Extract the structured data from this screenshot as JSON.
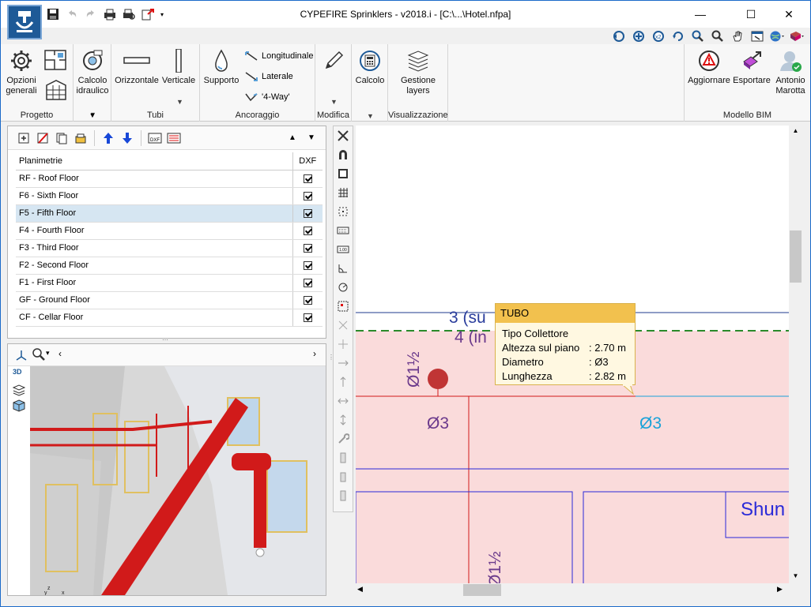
{
  "window": {
    "title": "CYPEFIRE Sprinklers - v2018.i - [C:\\...\\Hotel.nfpa]",
    "min_glyph": "—",
    "max_glyph": "☐",
    "close_glyph": "✕"
  },
  "ribbon": {
    "progetto": {
      "label": "Progetto",
      "opzioni": "Opzioni generali"
    },
    "calcolo_idraulico": {
      "label": "Calcolo idraulico"
    },
    "tubi": {
      "label": "Tubi",
      "orizzontale": "Orizzontale",
      "verticale": "Verticale"
    },
    "ancoraggio": {
      "label": "Ancoraggio",
      "supporto": "Supporto",
      "longitudinale": "Longitudinale",
      "laterale": "Laterale",
      "fourway": "'4-Way'"
    },
    "modifica": {
      "label": "Modifica"
    },
    "calcolo": {
      "label": "Calcolo",
      "btn": "Calcolo"
    },
    "visualizzazione": {
      "label": "Visualizzazione",
      "gestione": "Gestione layers"
    },
    "modello_bim": {
      "label": "Modello BIM",
      "aggiornare": "Aggiornare",
      "esportare": "Esportare",
      "user": "Antonio Marotta"
    }
  },
  "floors": {
    "header_name": "Planimetrie",
    "header_dxf": "DXF",
    "selected_index": 2,
    "items": [
      {
        "label": "RF - Roof Floor",
        "dxf": true
      },
      {
        "label": "F6 - Sixth Floor",
        "dxf": true
      },
      {
        "label": "F5 - Fifth Floor",
        "dxf": true
      },
      {
        "label": "F4 - Fourth Floor",
        "dxf": true
      },
      {
        "label": "F3 - Third Floor",
        "dxf": true
      },
      {
        "label": "F2 - Second Floor",
        "dxf": true
      },
      {
        "label": "F1 - First Floor",
        "dxf": true
      },
      {
        "label": "GF - Ground Floor",
        "dxf": true
      },
      {
        "label": "CF - Cellar Floor",
        "dxf": true
      }
    ]
  },
  "view3d": {
    "btn_3d": "3D",
    "axis_x": "x",
    "axis_y": "y",
    "axis_z": "z"
  },
  "drawing": {
    "label_3": "3 (su",
    "label_4": "4 (in",
    "pipe_dia_1_5": "Ø1½",
    "pipe_dia_3_left": "Ø3",
    "pipe_dia_3_right": "Ø3",
    "room_label": "Shun",
    "pipe_dia_bottom": "Ø1½"
  },
  "tooltip": {
    "title": "TUBO",
    "rows": [
      {
        "key": "Tipo Collettore",
        "value": ""
      },
      {
        "key": "Altezza sul piano",
        "value": ": 2.70 m"
      },
      {
        "key": "Diametro",
        "value": ": Ø3"
      },
      {
        "key": "Lunghezza",
        "value": ": 2.82 m"
      }
    ]
  },
  "colors": {
    "accent": "#1e5a97",
    "pipe_red": "#d11a1a",
    "room_fill": "#fadbdb",
    "tooltip_header": "#f2c14e",
    "label_purple": "#6b3a8c",
    "label_blue": "#1aa2d8",
    "label_navy": "#2a3d9c"
  }
}
